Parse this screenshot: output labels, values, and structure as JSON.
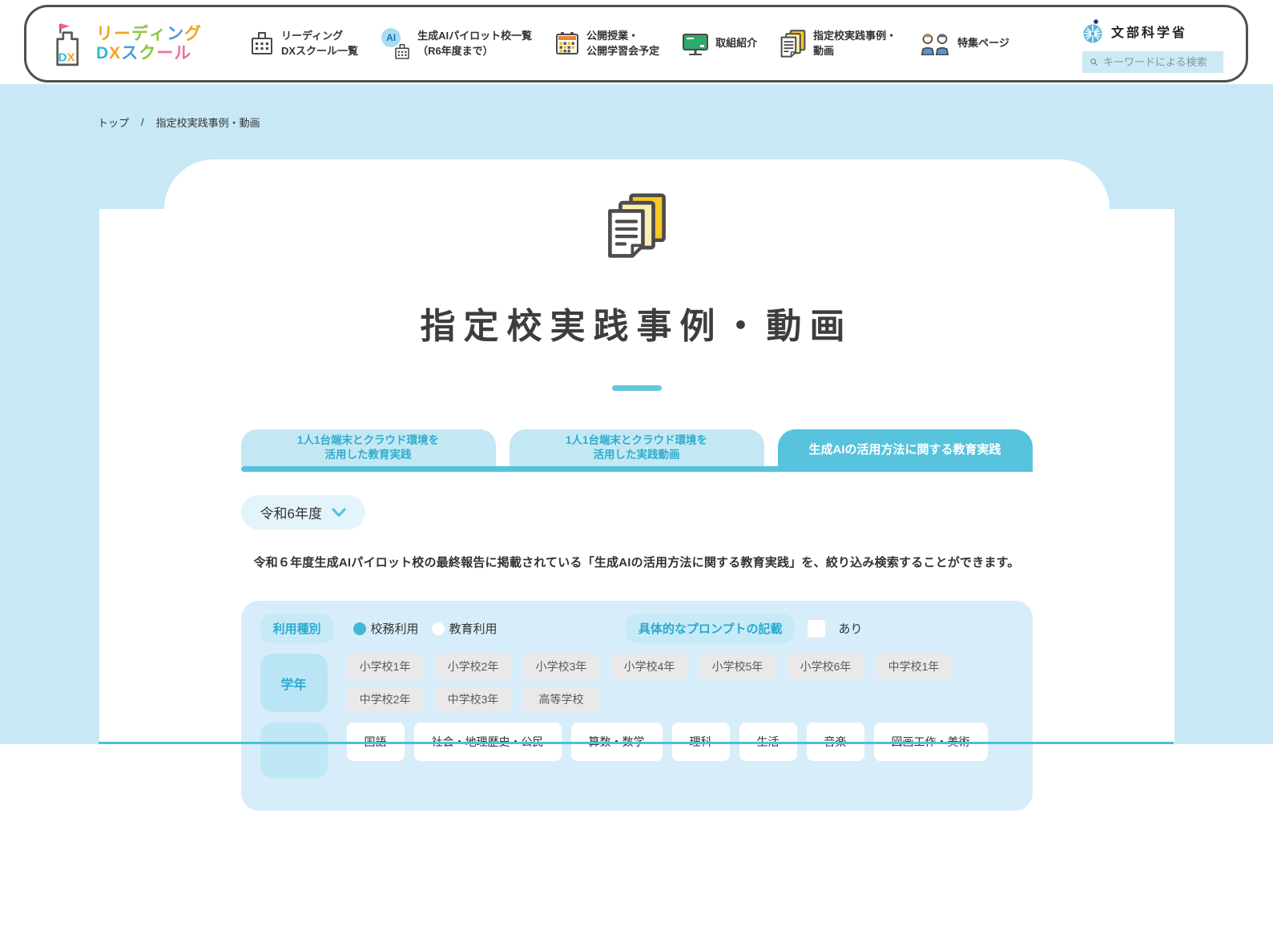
{
  "header": {
    "logo": {
      "l1": [
        "リ",
        "ー",
        "デ",
        "ィ",
        "ン",
        "グ"
      ],
      "l2": [
        "D",
        "X",
        "ス",
        "ク",
        "ー",
        "ル"
      ]
    },
    "nav": [
      {
        "icon": "school-icon",
        "line1": "リーディング",
        "line2": "DXスクール一覧"
      },
      {
        "icon": "ai-school-icon",
        "badge": "AI",
        "line1": "生成AIパイロット校一覧",
        "line2": "（R6年度まで）"
      },
      {
        "icon": "calendar-icon",
        "line1": "公開授業・",
        "line2": "公開学習会予定"
      },
      {
        "icon": "blackboard-icon",
        "line1": "取組紹介"
      },
      {
        "icon": "documents-icon",
        "line1": "指定校実践事例・",
        "line2": "動画"
      },
      {
        "icon": "people-icon",
        "line1": "特集ページ"
      }
    ],
    "mext": {
      "label": "文部科学省"
    },
    "search": {
      "placeholder": "キーワードによる検索"
    }
  },
  "breadcrumb": {
    "home": "トップ",
    "separator": "/",
    "current": "指定校実践事例・動画"
  },
  "main": {
    "title": "指定校実践事例・動画",
    "tabs": [
      {
        "line1": "1人1台端末とクラウド環境を",
        "line2": "活用した教育実践",
        "active": false
      },
      {
        "line1": "1人1台端末とクラウド環境を",
        "line2": "活用した実践動画",
        "active": false
      },
      {
        "line1": "生成AIの活用方法に関する教育実践",
        "active": true
      }
    ],
    "year_select": {
      "value": "令和6年度"
    },
    "description": "令和６年度生成AIパイロット校の最終報告に掲載されている「生成AIの活用方法に関する教育実践」を、絞り込み検索することができます。",
    "filters": {
      "usage_type": {
        "label": "利用種別",
        "options": [
          {
            "label": "校務利用",
            "selected": true
          },
          {
            "label": "教育利用",
            "selected": false
          }
        ]
      },
      "prompt": {
        "label": "具体的なプロンプトの記載",
        "checkbox_label": "あり",
        "checked": false
      },
      "grade": {
        "label": "学年",
        "options": [
          "小学校1年",
          "小学校2年",
          "小学校3年",
          "小学校4年",
          "小学校5年",
          "小学校6年",
          "中学校1年",
          "中学校2年",
          "中学校3年",
          "高等学校"
        ]
      },
      "subject": {
        "options": [
          "国語",
          "社会・地理歴史・公民",
          "算数・数学",
          "理科",
          "生活",
          "音楽",
          "図画工作・美術"
        ]
      }
    }
  },
  "colors": {
    "page_bg": "#c8e8f5",
    "accent_teal": "#57c3dd",
    "tab_inactive_bg": "#c3e8f4",
    "tab_inactive_text": "#2fadce",
    "panel_bg": "#d7eefa",
    "label_pill_bg": "#c6ebf7",
    "label_pill_text": "#2aa9cd",
    "grade_button_bg": "#e9e9e9",
    "doc_yellow": "#f7c927",
    "logo_orange": "#f5a21d",
    "logo_green": "#8cc63f",
    "logo_blue": "#4a9fdc",
    "logo_pink": "#f06fa0",
    "logo_teal": "#2ebcd4",
    "mext_blue": "#58b5d9",
    "header_border": "#4f4f4f"
  }
}
